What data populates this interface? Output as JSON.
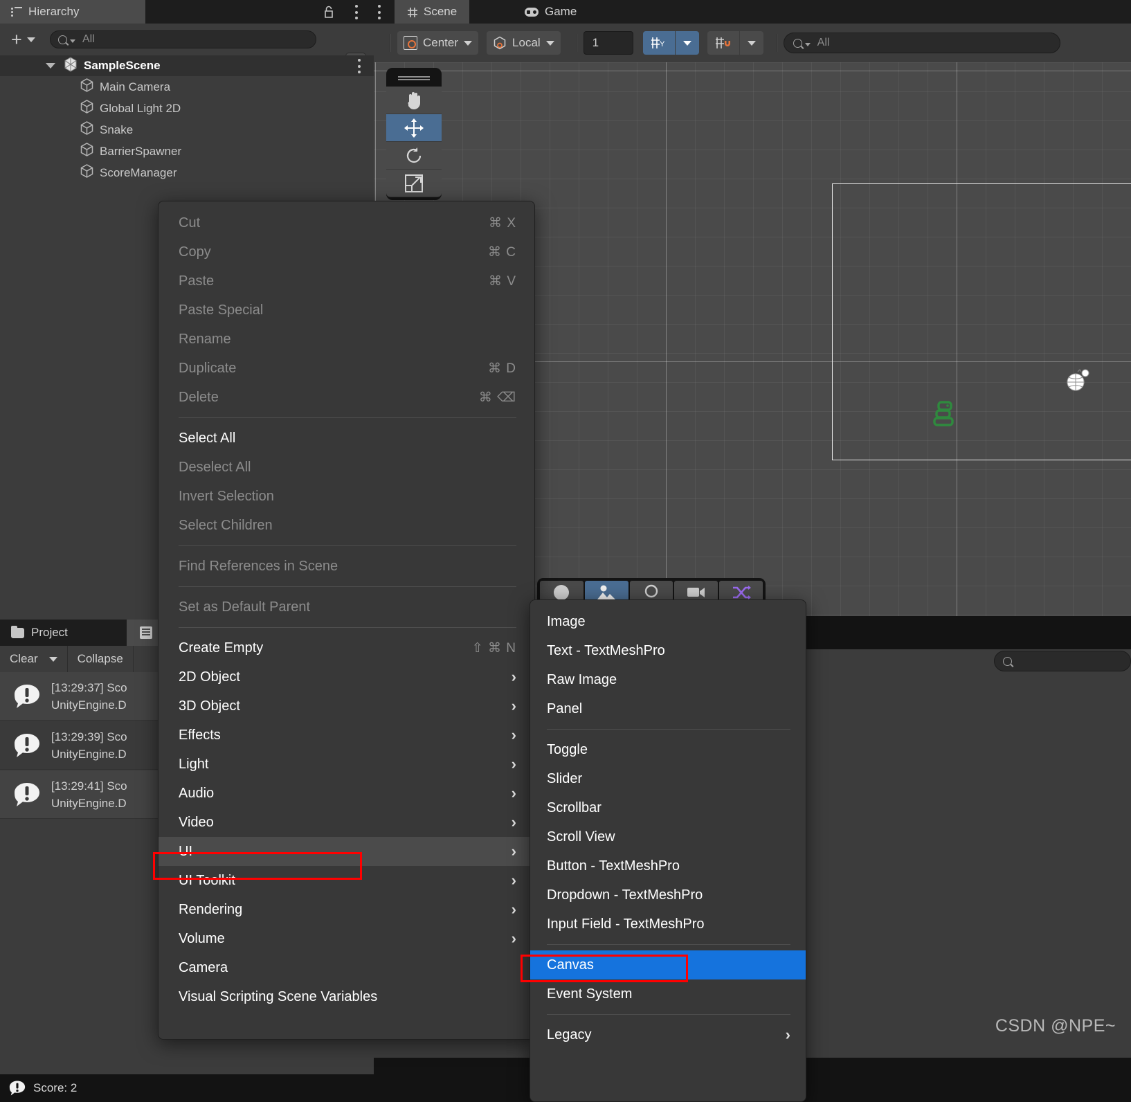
{
  "hierarchy": {
    "tab_label": "Hierarchy",
    "tab_icon": "hierarchy-list-icon",
    "lock_icon": "lock-open-icon",
    "menu_icon": "kebab-menu-icon",
    "add_label": "+",
    "search_placeholder": "All",
    "search_icon": "search-icon",
    "expand_icon": "expand-external-icon",
    "scene_name": "SampleScene",
    "items": [
      {
        "label": "Main Camera",
        "icon": "gameobject-cube-icon"
      },
      {
        "label": "Global Light 2D",
        "icon": "gameobject-cube-icon"
      },
      {
        "label": "Snake",
        "icon": "gameobject-cube-icon"
      },
      {
        "label": "BarrierSpawner",
        "icon": "gameobject-cube-icon"
      },
      {
        "label": "ScoreManager",
        "icon": "gameobject-cube-icon"
      }
    ]
  },
  "view_tabs": [
    {
      "label": "Scene",
      "icon": "grid-hash-icon",
      "active": true
    },
    {
      "label": "Game",
      "icon": "gamepad-icon",
      "active": false
    }
  ],
  "scene_toolbar": {
    "pivot_mode": "Center",
    "pivot_icon": "pivot-center-icon",
    "handle_space": "Local",
    "handle_icon": "local-space-cube-icon",
    "grid_size_value": "1",
    "grid_snap_icon": "grid-axis-y-icon",
    "grid_snap_dropdown_icon": "chevron-down-icon",
    "snap_increment_icon": "grid-magnet-icon",
    "snap_dropdown_icon": "chevron-down-icon",
    "search_placeholder": "All",
    "search_icon": "search-icon"
  },
  "scene_tools": [
    {
      "name": "hand-tool",
      "icon": "hand-icon",
      "selected": false
    },
    {
      "name": "move-tool",
      "icon": "move-arrows-icon",
      "selected": true
    },
    {
      "name": "rotate-tool",
      "icon": "rotate-icon",
      "selected": false
    },
    {
      "name": "scale-tool",
      "icon": "scale-icon",
      "selected": false
    }
  ],
  "scene_overlay_tools": [
    {
      "name": "shape-tool",
      "icon": "circle-filled-icon",
      "selected": false
    },
    {
      "name": "sprite-tool",
      "icon": "image-mountain-icon",
      "selected": true
    },
    {
      "name": "collider-tool",
      "icon": "circle-outline-icon",
      "selected": false
    },
    {
      "name": "camera-tool",
      "icon": "camera-icon",
      "selected": false
    },
    {
      "name": "shuffle-tool",
      "icon": "shuffle-arrows-icon",
      "selected": false
    }
  ],
  "viewport": {
    "snake_sprite_name": "snake-sprite",
    "light_gizmo_name": "global-light-gizmo",
    "canvas_bounds_name": "camera-bounds-rect",
    "grid_color": "#4a4a4a"
  },
  "project_panel": {
    "tab_label": "Project",
    "folder_icon": "folder-icon",
    "console_tab_icon": "console-list-icon",
    "clear_label": "Clear",
    "clear_caret_icon": "chevron-down-icon",
    "collapse_label": "Collapse",
    "logs": [
      {
        "line1": "[13:29:37] Sco",
        "line2": "UnityEngine.D",
        "icon": "error-exclaim-icon"
      },
      {
        "line1": "[13:29:39] Sco",
        "line2": "UnityEngine.D",
        "icon": "error-exclaim-icon"
      },
      {
        "line1": "[13:29:41] Sco",
        "line2": "UnityEngine.D",
        "icon": "error-exclaim-icon"
      }
    ],
    "status_text": "Score: 2",
    "status_icon": "error-exclaim-icon"
  },
  "inspector": {
    "search_icon": "search-icon"
  },
  "context_menu": {
    "groups": [
      {
        "items": [
          {
            "label": "Cut",
            "shortcut": "⌘ X",
            "dim": true
          },
          {
            "label": "Copy",
            "shortcut": "⌘ C",
            "dim": true
          },
          {
            "label": "Paste",
            "shortcut": "⌘ V",
            "dim": true
          },
          {
            "label": "Paste Special",
            "shortcut": "",
            "dim": true
          },
          {
            "label": "Rename",
            "shortcut": "",
            "dim": true
          },
          {
            "label": "Duplicate",
            "shortcut": "⌘ D",
            "dim": true
          },
          {
            "label": "Delete",
            "shortcut": "⌘ ⌫",
            "dim": true
          }
        ]
      },
      {
        "items": [
          {
            "label": "Select All",
            "shortcut": "",
            "dim": false
          },
          {
            "label": "Deselect All",
            "shortcut": "",
            "dim": true
          },
          {
            "label": "Invert Selection",
            "shortcut": "",
            "dim": true
          },
          {
            "label": "Select Children",
            "shortcut": "",
            "dim": true
          }
        ]
      },
      {
        "items": [
          {
            "label": "Find References in Scene",
            "shortcut": "",
            "dim": true
          }
        ]
      },
      {
        "items": [
          {
            "label": "Set as Default Parent",
            "shortcut": "",
            "dim": true
          }
        ]
      },
      {
        "items": [
          {
            "label": "Create Empty",
            "shortcut": "⇧ ⌘ N",
            "dim": false
          },
          {
            "label": "2D Object",
            "submenu": true,
            "dim": false
          },
          {
            "label": "3D Object",
            "submenu": true,
            "dim": false
          },
          {
            "label": "Effects",
            "submenu": true,
            "dim": false
          },
          {
            "label": "Light",
            "submenu": true,
            "dim": false
          },
          {
            "label": "Audio",
            "submenu": true,
            "dim": false
          },
          {
            "label": "Video",
            "submenu": true,
            "dim": false
          },
          {
            "label": "UI",
            "submenu": true,
            "dim": false,
            "highlighted": true,
            "outlined": true
          },
          {
            "label": "UI Toolkit",
            "submenu": true,
            "dim": false
          },
          {
            "label": "Rendering",
            "submenu": true,
            "dim": false
          },
          {
            "label": "Volume",
            "submenu": true,
            "dim": false
          },
          {
            "label": "Camera",
            "submenu": false,
            "dim": false
          },
          {
            "label": "Visual Scripting Scene Variables",
            "submenu": false,
            "dim": false
          }
        ]
      }
    ]
  },
  "ui_submenu": {
    "groups": [
      {
        "items": [
          {
            "label": "Image"
          },
          {
            "label": "Text - TextMeshPro"
          },
          {
            "label": "Raw Image"
          },
          {
            "label": "Panel"
          }
        ]
      },
      {
        "items": [
          {
            "label": "Toggle"
          },
          {
            "label": "Slider"
          },
          {
            "label": "Scrollbar"
          },
          {
            "label": "Scroll View"
          },
          {
            "label": "Button - TextMeshPro"
          },
          {
            "label": "Dropdown - TextMeshPro"
          },
          {
            "label": "Input Field - TextMeshPro"
          }
        ]
      },
      {
        "items": [
          {
            "label": "Canvas",
            "selected": true,
            "outlined": true
          },
          {
            "label": "Event System"
          }
        ]
      },
      {
        "items": [
          {
            "label": "Legacy",
            "submenu": true
          }
        ]
      }
    ]
  },
  "watermark": "CSDN @NPE~",
  "colors": {
    "accent_blue": "#1573dd",
    "tool_selected_blue": "#4a6d93",
    "highlight_red": "#ff0000",
    "snake_green": "#2f8a3e",
    "panel_bg": "#3c3c3c",
    "menu_bg": "#383838",
    "dark_bg": "#1d1d1d"
  }
}
